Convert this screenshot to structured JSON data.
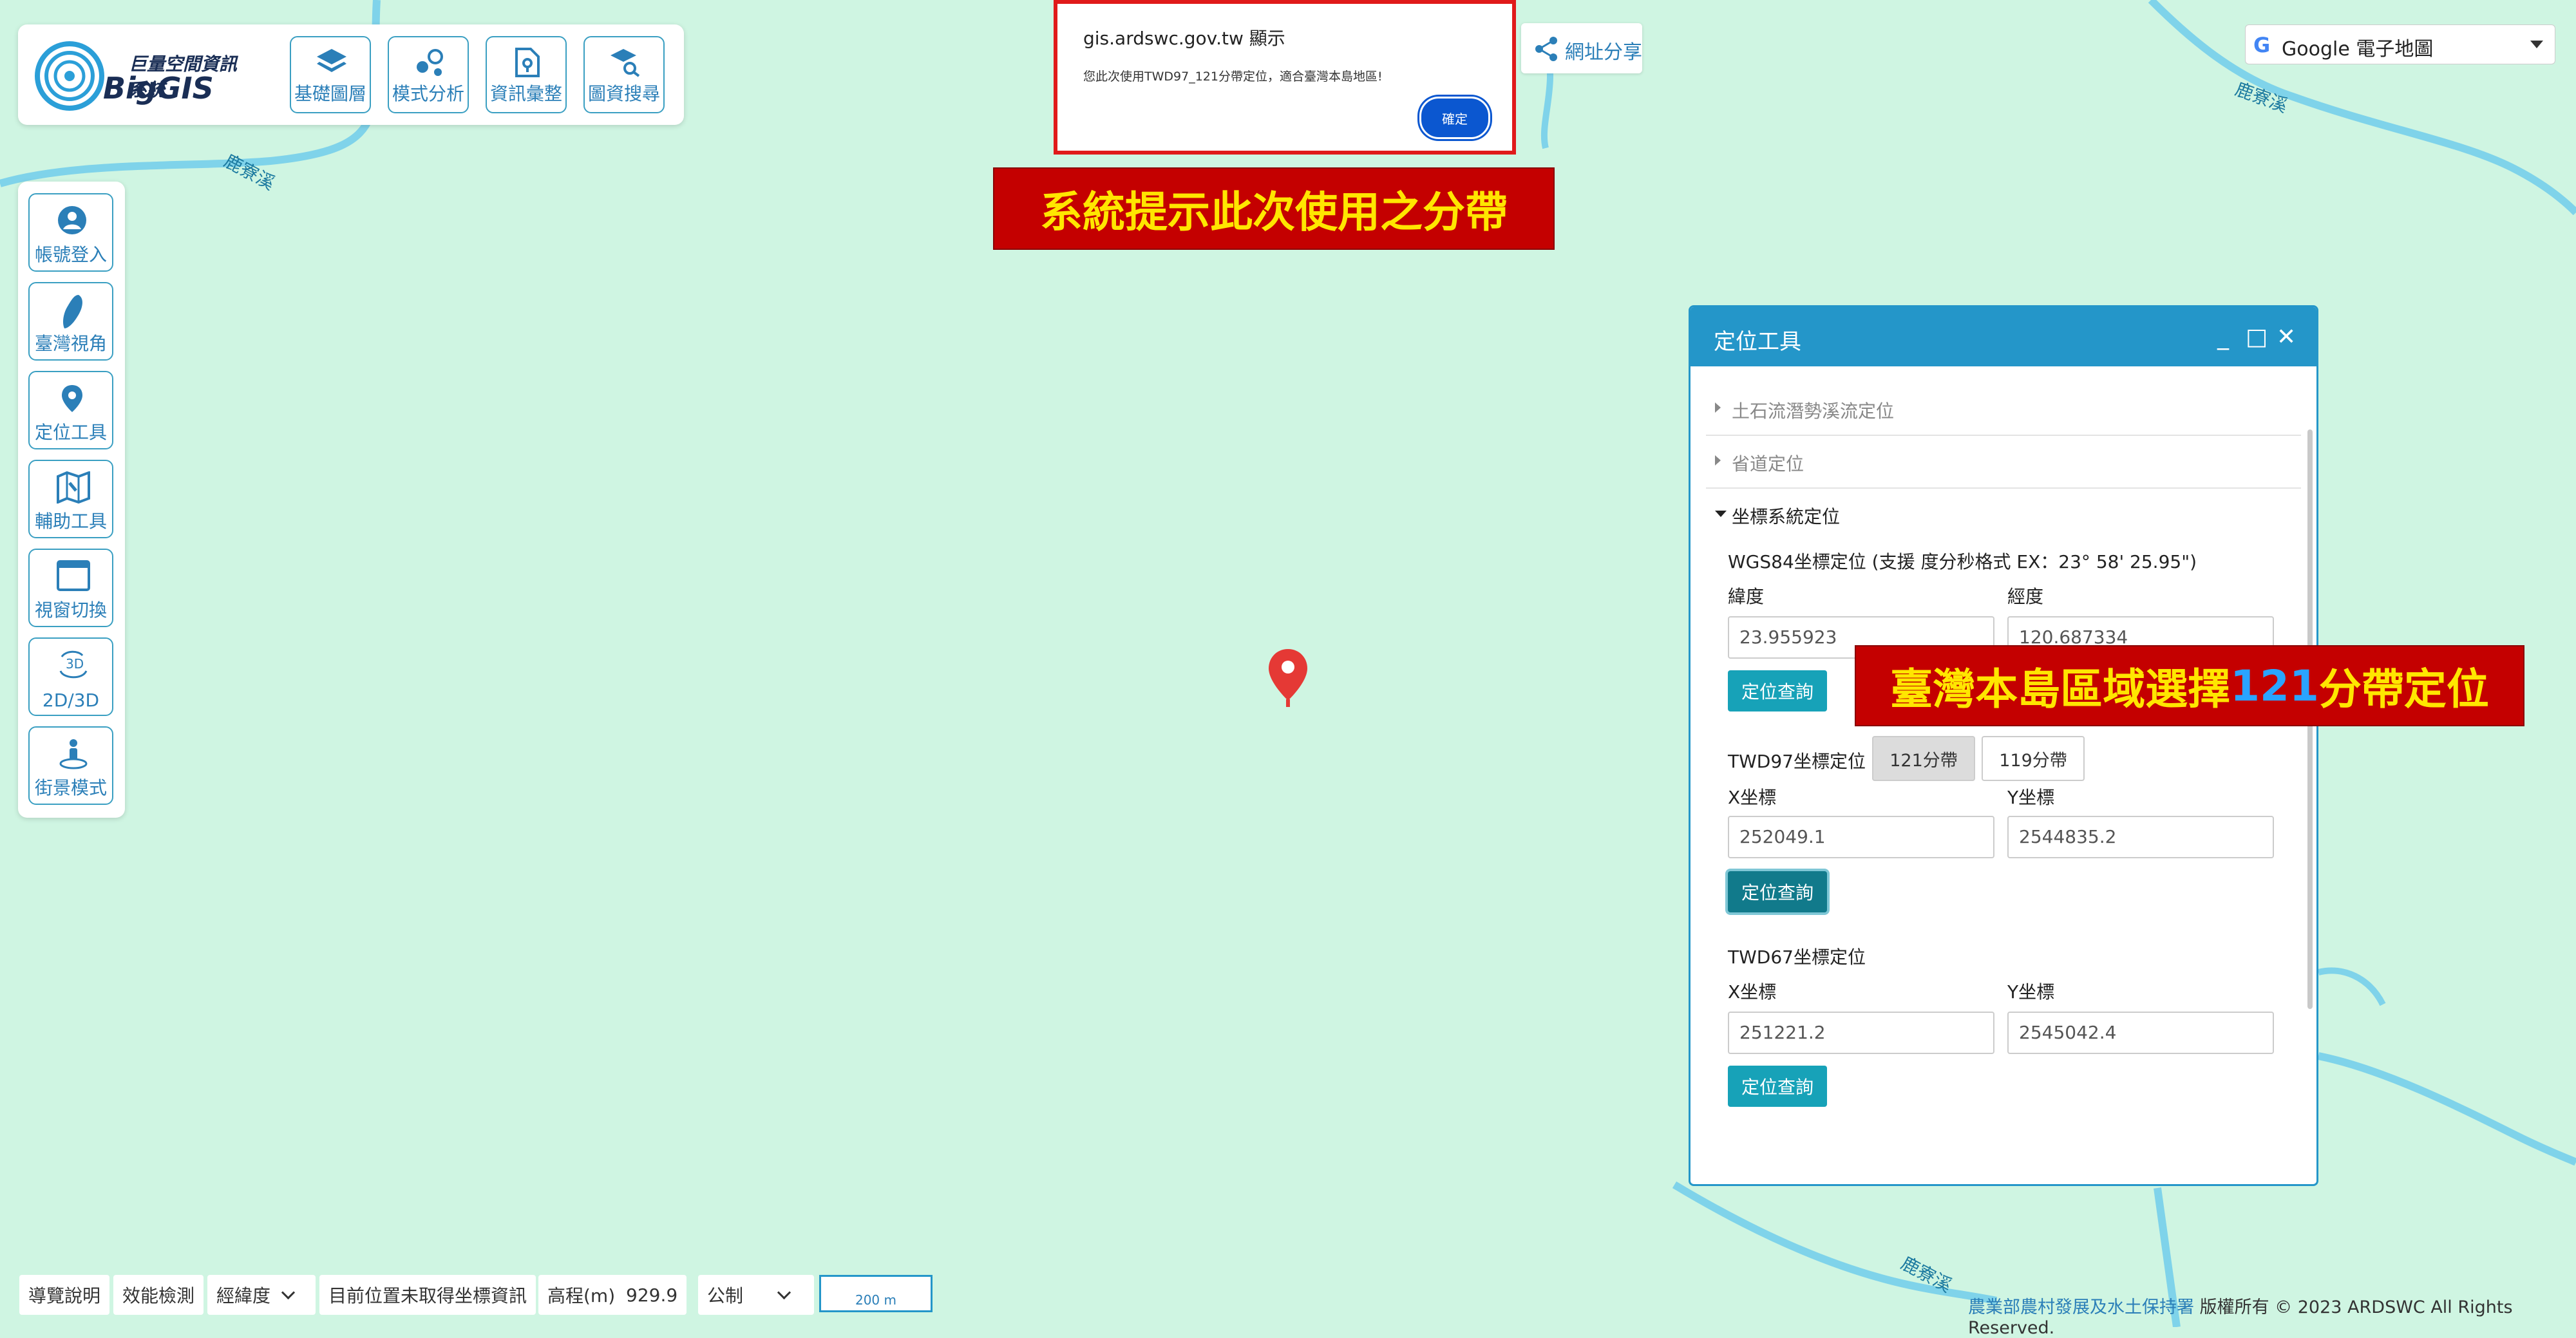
{
  "logo": {
    "title_cn": "巨量空間資訊系統",
    "title_en": "BigGIS"
  },
  "top_tools": [
    {
      "label": "基礎圖層",
      "icon": "layers-icon"
    },
    {
      "label": "模式分析",
      "icon": "analysis-icon"
    },
    {
      "label": "資訊彙整",
      "icon": "file-location-icon"
    },
    {
      "label": "圖資搜尋",
      "icon": "layer-search-icon"
    }
  ],
  "side_tools": [
    {
      "label": "帳號登入",
      "icon": "user-icon"
    },
    {
      "label": "臺灣視角",
      "icon": "taiwan-icon"
    },
    {
      "label": "定位工具",
      "icon": "location-pin-icon"
    },
    {
      "label": "輔助工具",
      "icon": "map-tools-icon"
    },
    {
      "label": "視窗切換",
      "icon": "window-icon"
    },
    {
      "label": "2D/3D",
      "icon": "rotate-3d-icon"
    },
    {
      "label": "街景模式",
      "icon": "street-view-icon"
    }
  ],
  "alert": {
    "title": "gis.ardswc.gov.tw 顯示",
    "message": "您此次使用TWD97_121分帶定位，適合臺灣本島地區!",
    "ok_label": "確定"
  },
  "banner_top": "系統提示此次使用之分帶",
  "share": {
    "label": "網址分享"
  },
  "basemap": {
    "g": "G",
    "selected": "Google 電子地圖"
  },
  "map_labels": [
    "鹿寮溪",
    "鹿寮溪",
    "鹿寮溪"
  ],
  "panel": {
    "title": "定位工具",
    "controls": {
      "minimize": "_",
      "maximize": "□",
      "close": "✕"
    },
    "sections": [
      "土石流潛勢溪流定位",
      "省道定位",
      "坐標系統定位"
    ],
    "wgs84": {
      "title": "WGS84坐標定位 (支援 度分秒格式 EX：23° 58' 25.95\")",
      "lat_label": "緯度",
      "lat_value": "23.955923",
      "lon_label": "經度",
      "lon_value": "120.687334",
      "query_label": "定位查詢"
    },
    "twd97": {
      "title": "TWD97坐標定位",
      "zone_121": "121分帶",
      "zone_119": "119分帶",
      "x_label": "X坐標",
      "x_value": "252049.1",
      "y_label": "Y坐標",
      "y_value": "2544835.2",
      "query_label": "定位查詢"
    },
    "twd67": {
      "title": "TWD67坐標定位",
      "x_label": "X坐標",
      "x_value": "251221.2",
      "y_label": "Y坐標",
      "y_value": "2545042.4",
      "query_label": "定位查詢"
    }
  },
  "banner_right": {
    "prefix": "臺灣本島區域選擇 ",
    "number": "121",
    "suffix": "分帶定位"
  },
  "status_bar": {
    "guide": "導覽說明",
    "perf": "效能檢測",
    "coord_type": "經緯度",
    "coord_info": "目前位置未取得坐標資訊",
    "elev_label": "高程(m)",
    "elev_value": "929.9",
    "unit": "公制",
    "scale": "200 m"
  },
  "copyright": {
    "agency": "農業部農村發展及水土保持署",
    "rights": " 版權所有 © 2023 ARDSWC All Rights Reserved."
  },
  "colors": {
    "map_bg": "#cff5e2",
    "river": "#7fd3ea",
    "accent": "#2496c9",
    "banner": "#c40000",
    "banner_text": "#ffe600"
  }
}
